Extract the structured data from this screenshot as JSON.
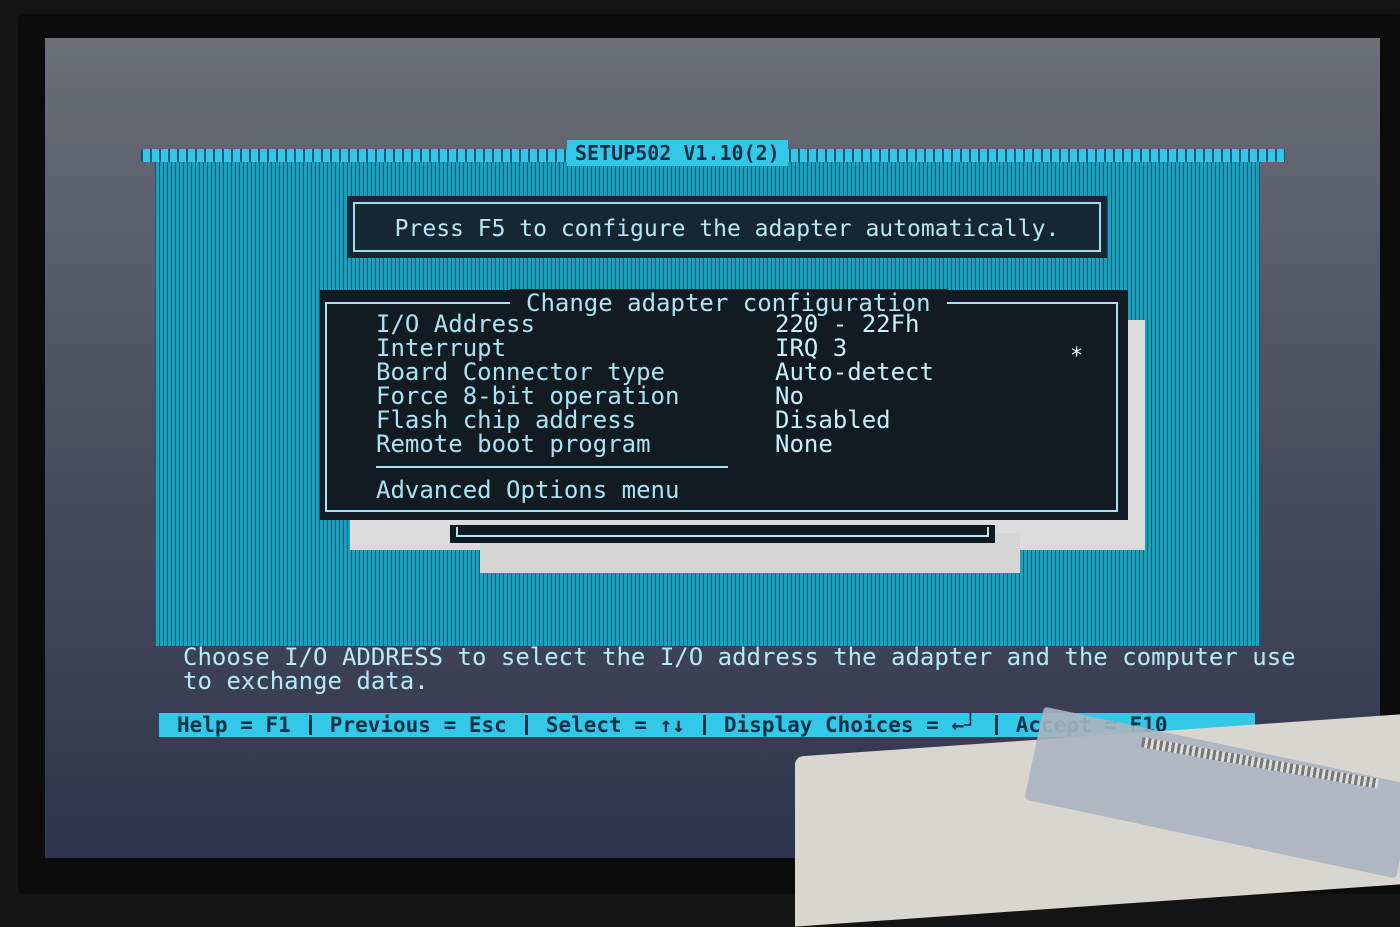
{
  "title_bar": {
    "text": "SETUP502 V1.10(2)"
  },
  "notice": {
    "text": "Press F5 to configure the adapter automatically."
  },
  "dialog": {
    "title": "Change adapter configuration",
    "items": [
      {
        "label": "I/O Address",
        "value": "220 - 22Fh"
      },
      {
        "label": "Interrupt",
        "value": "IRQ 3"
      },
      {
        "label": "Board Connector type",
        "value": "Auto-detect"
      },
      {
        "label": "Force 8-bit operation",
        "value": "No"
      },
      {
        "label": "Flash chip address",
        "value": "Disabled"
      },
      {
        "label": "Remote boot program",
        "value": "None"
      }
    ],
    "changed_marker": "*",
    "advanced": "Advanced Options menu"
  },
  "help": {
    "line1": "Choose I/O ADDRESS to select the I/O address the adapter and the computer use",
    "line2": "to exchange data."
  },
  "function_keys": [
    "Help = F1",
    "Previous = Esc",
    "Select = ↑↓",
    "Display Choices = ←┘",
    "Accept = F10"
  ],
  "colors": {
    "screen_bg": "#1aa0bf",
    "highlight_bar": "#34c8e8",
    "dialog_bg": "#121a22",
    "text": "#a9e4f4"
  }
}
